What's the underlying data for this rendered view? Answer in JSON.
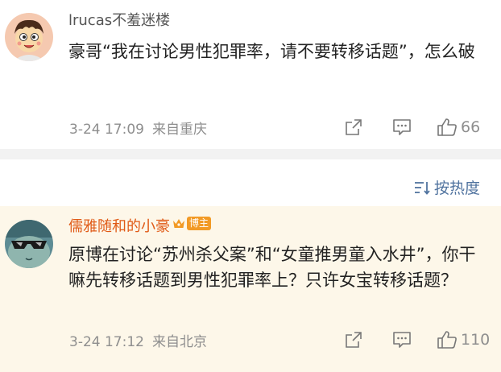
{
  "comments": [
    {
      "username": "lrucas不羞迷楼",
      "text": "豪哥“我在讨论男性犯罪率，请不要转移话题”，怎么破",
      "date": "3-24 17:09",
      "location": "来自重庆",
      "likes": "66",
      "avatar": "cartoon-boy-avatar"
    },
    {
      "username": "儒雅随和的小豪",
      "badge": "博主",
      "text": "原博在讨论“苏州杀父案”和“女童推男童入水井”，你干嘛先转移话题到男性犯罪率上？只许女宝转移话题？",
      "date": "3-24 17:12",
      "location": "来自北京",
      "likes": "110",
      "avatar": "sunglasses-avatar"
    }
  ],
  "sort": {
    "label": "按热度",
    "icon": "sort-icon"
  },
  "icons": {
    "share": "share-icon",
    "reply": "comment-icon",
    "like": "thumbs-up-icon"
  },
  "colors": {
    "blogger_name": "#e05a16",
    "badge": "#f29a25",
    "sort_link": "#50739f",
    "highlight_bg": "#fdf7e9"
  }
}
